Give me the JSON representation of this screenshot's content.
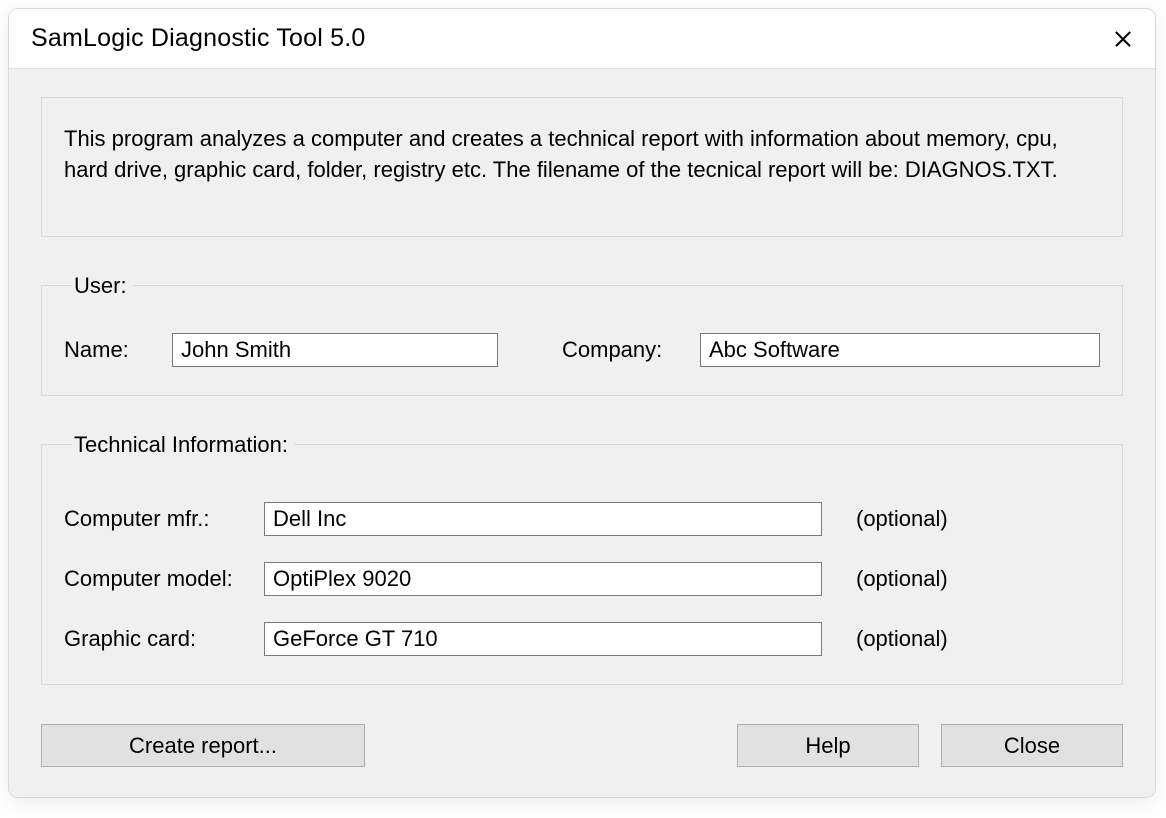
{
  "window": {
    "title": "SamLogic Diagnostic Tool  5.0"
  },
  "description": "This program analyzes a computer and creates a technical report with information about memory, cpu, hard drive, graphic card, folder, registry etc. The filename of the tecnical report will be: DIAGNOS.TXT.",
  "user": {
    "legend": "User:",
    "name_label": "Name:",
    "name_value": "John Smith",
    "company_label": "Company:",
    "company_value": "Abc Software"
  },
  "tech": {
    "legend": "Technical Information:",
    "mfr_label": "Computer mfr.:",
    "mfr_value": "Dell Inc",
    "mfr_hint": "(optional)",
    "model_label": "Computer model:",
    "model_value": "OptiPlex 9020",
    "model_hint": "(optional)",
    "gpu_label": "Graphic card:",
    "gpu_value": "GeForce GT 710",
    "gpu_hint": "(optional)"
  },
  "buttons": {
    "create": "Create report...",
    "help": "Help",
    "close": "Close"
  }
}
